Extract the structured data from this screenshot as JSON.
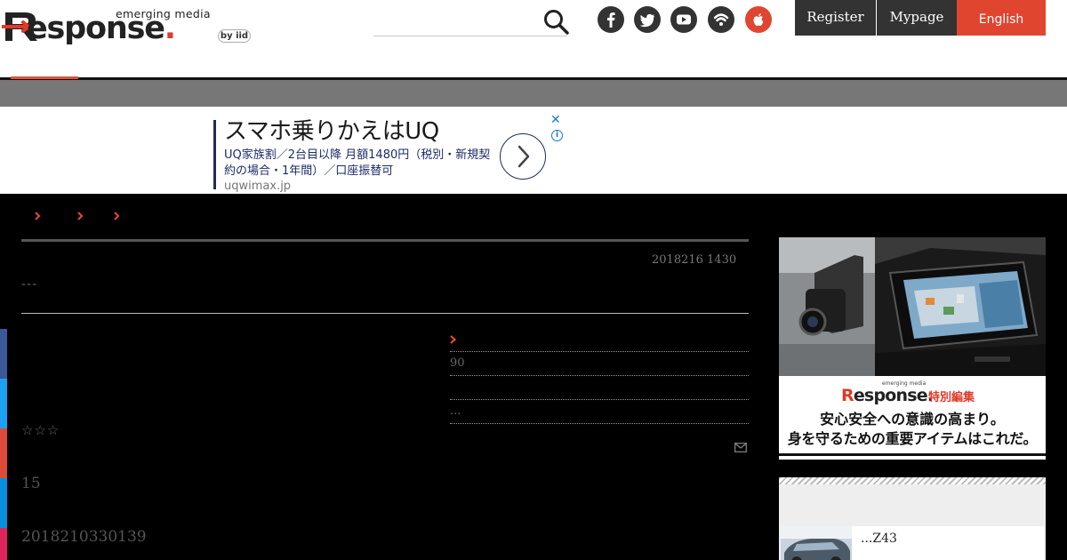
{
  "header": {
    "logo_tagline": "emerging media",
    "logo_text": "esponse",
    "logo_by": "by iid",
    "buttons": {
      "register": "Register",
      "mypage": "Mypage",
      "language": "English"
    }
  },
  "ad": {
    "title": "スマホ乗りかえはUQ",
    "body": "UQ家族割／2台目以降 月額1480円（税別・新規契約の場合・1年間）／口座振替可",
    "url": "uqwimax.jp",
    "close": "✕",
    "info": "i"
  },
  "article": {
    "date": "2018216 1430",
    "subtitle": "---",
    "related": [
      "90",
      "",
      "..."
    ],
    "rating": "☆☆☆",
    "count": "15",
    "pubdate": "2018210330139"
  },
  "sidebar": {
    "promo": {
      "logo_sub": "emerging media",
      "logo_text": "esponse.",
      "tag": "特別編集",
      "line1": "安心安全への意識の高まり。",
      "line2": "身を守るための重要アイテムはこれだ。"
    },
    "card_title": "...Z43"
  },
  "colors": {
    "accent": "#e0452f",
    "share": [
      "#3b5998",
      "#1da1f2",
      "#dd4b39",
      "#0a8fde",
      "#e0245e"
    ]
  }
}
